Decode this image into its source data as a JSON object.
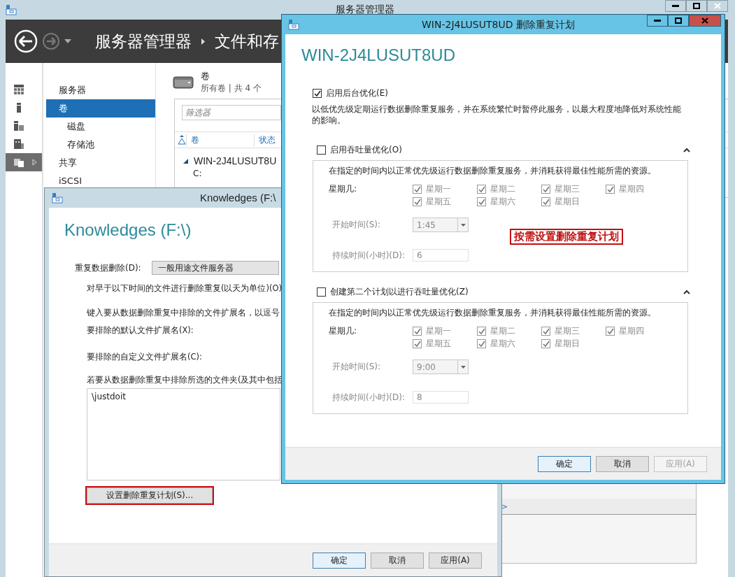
{
  "server_manager": {
    "title": "服务器管理器",
    "breadcrumb": [
      "服务器管理器",
      "文件和存"
    ],
    "rail": [
      {
        "selected": false
      },
      {
        "selected": false
      },
      {
        "selected": false
      },
      {
        "selected": false
      },
      {
        "selected": true
      }
    ],
    "nav": [
      {
        "label": "服务器",
        "selected": false
      },
      {
        "label": "卷",
        "selected": true,
        "children": [
          {
            "label": "磁盘",
            "selected": false
          },
          {
            "label": "存储池",
            "selected": false
          }
        ]
      },
      {
        "label": "共享",
        "selected": false
      },
      {
        "label": "iSCSI",
        "selected": false
      }
    ],
    "volumes": {
      "title": "卷",
      "subtitle": "所有卷 | 共 4 个",
      "filter": {
        "placeholder": "筛选器"
      },
      "columns": [
        "卷",
        "状态"
      ],
      "group": {
        "label": "WIN-2J4LUSUT8U",
        "expanded": true,
        "rows": [
          "C:"
        ]
      }
    },
    "lower_panel": {
      "text": ">"
    }
  },
  "properties_dialog": {
    "title": "Knowledges (F:\\",
    "heading": "Knowledges (F:\\)",
    "dedup_label": "重复数据删除(D):",
    "dedup_value": "一般用途文件服务器",
    "lines": [
      "对早于以下时间的文件进行删除重复(以天为单位)(O)",
      "键入要从数据删除重复中排除的文件扩展名，以逗号",
      "要排除的默认文件扩展名(X):",
      "要排除的自定义文件扩展名(C):",
      "若要从数据删除重复中排除所选的文件夹(及其中包括"
    ],
    "excluded_folders": [
      "\\justdoit"
    ],
    "schedule_button": {
      "label": "设置删除重复计划(S)...",
      "highlighted": true
    },
    "buttons": [
      {
        "label": "确定",
        "default": true,
        "disabled": false
      },
      {
        "label": "取消",
        "default": false,
        "disabled": false
      },
      {
        "label": "应用(A)",
        "default": false,
        "disabled": false
      }
    ]
  },
  "schedule_dialog": {
    "title": "WIN-2J4LUSUT8UD 删除重复计划",
    "heading": "WIN-2J4LUSUT8UD",
    "background_optimization": {
      "label": "启用后台优化(E)",
      "checked": true,
      "description": "以低优先级定期运行数据删除重复服务，并在系统繁忙时暂停此服务，以最大程度地降低对系统性能的影响。"
    },
    "schedules": [
      {
        "label": "启用吞吐量优化(O)",
        "checked": false,
        "expanded": true,
        "description": "在指定的时间内以正常优先级运行数据删除重复服务，并消耗获得最佳性能所需的资源。",
        "days_label": "星期几:",
        "days": [
          {
            "label": "星期一",
            "checked": true
          },
          {
            "label": "星期二",
            "checked": true
          },
          {
            "label": "星期三",
            "checked": true
          },
          {
            "label": "星期四",
            "checked": true
          },
          {
            "label": "星期五",
            "checked": true
          },
          {
            "label": "星期六",
            "checked": true
          },
          {
            "label": "星期日",
            "checked": true
          }
        ],
        "start_label": "开始时间(S):",
        "start_time": "1:45",
        "duration_label": "持续时间(小时)(D):",
        "duration": "6",
        "annotation": "按需设置删除重复计划"
      },
      {
        "label": "创建第二个计划以进行吞吐量优化(Z)",
        "checked": false,
        "expanded": true,
        "description": "在指定的时间内以正常优先级运行数据删除重复服务，并消耗获得最佳性能所需的资源。",
        "days_label": "星期几:",
        "days": [
          {
            "label": "星期一",
            "checked": true
          },
          {
            "label": "星期二",
            "checked": true
          },
          {
            "label": "星期三",
            "checked": true
          },
          {
            "label": "星期四",
            "checked": true
          },
          {
            "label": "星期五",
            "checked": true
          },
          {
            "label": "星期六",
            "checked": true
          },
          {
            "label": "星期日",
            "checked": true
          }
        ],
        "start_label": "开始时间(S):",
        "start_time": "9:00",
        "duration_label": "持续时间(小时)(D):",
        "duration": "8"
      }
    ],
    "buttons": [
      {
        "label": "确定",
        "default": true,
        "disabled": false
      },
      {
        "label": "取消",
        "default": false,
        "disabled": false
      },
      {
        "label": "应用(A)",
        "default": false,
        "disabled": true
      }
    ]
  }
}
